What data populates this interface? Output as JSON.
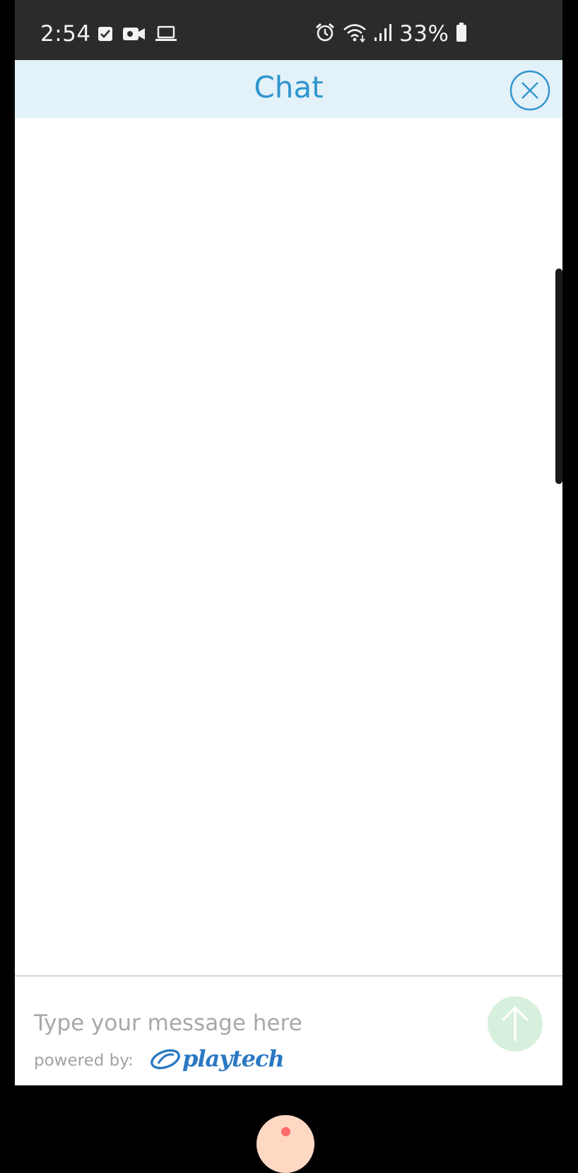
{
  "status_bar": {
    "time": "2:54",
    "battery_percent": "33%",
    "left_icons": [
      "check-notification-icon",
      "video-camera-icon",
      "laptop-icon"
    ],
    "right_icons": [
      "alarm-icon",
      "wifi-icon",
      "signal-icon",
      "battery-icon"
    ]
  },
  "chat": {
    "title": "Chat",
    "close_icon": "close-circle-icon",
    "input_placeholder": "Type your message here",
    "send_icon": "arrow-up-icon",
    "powered_by": "powered by:",
    "brand": "playtech",
    "colors": {
      "header_bg": "#e3f1f8",
      "accent": "#2e95cf",
      "send_bg": "#d7f0de",
      "brand": "#2a79c2"
    }
  }
}
